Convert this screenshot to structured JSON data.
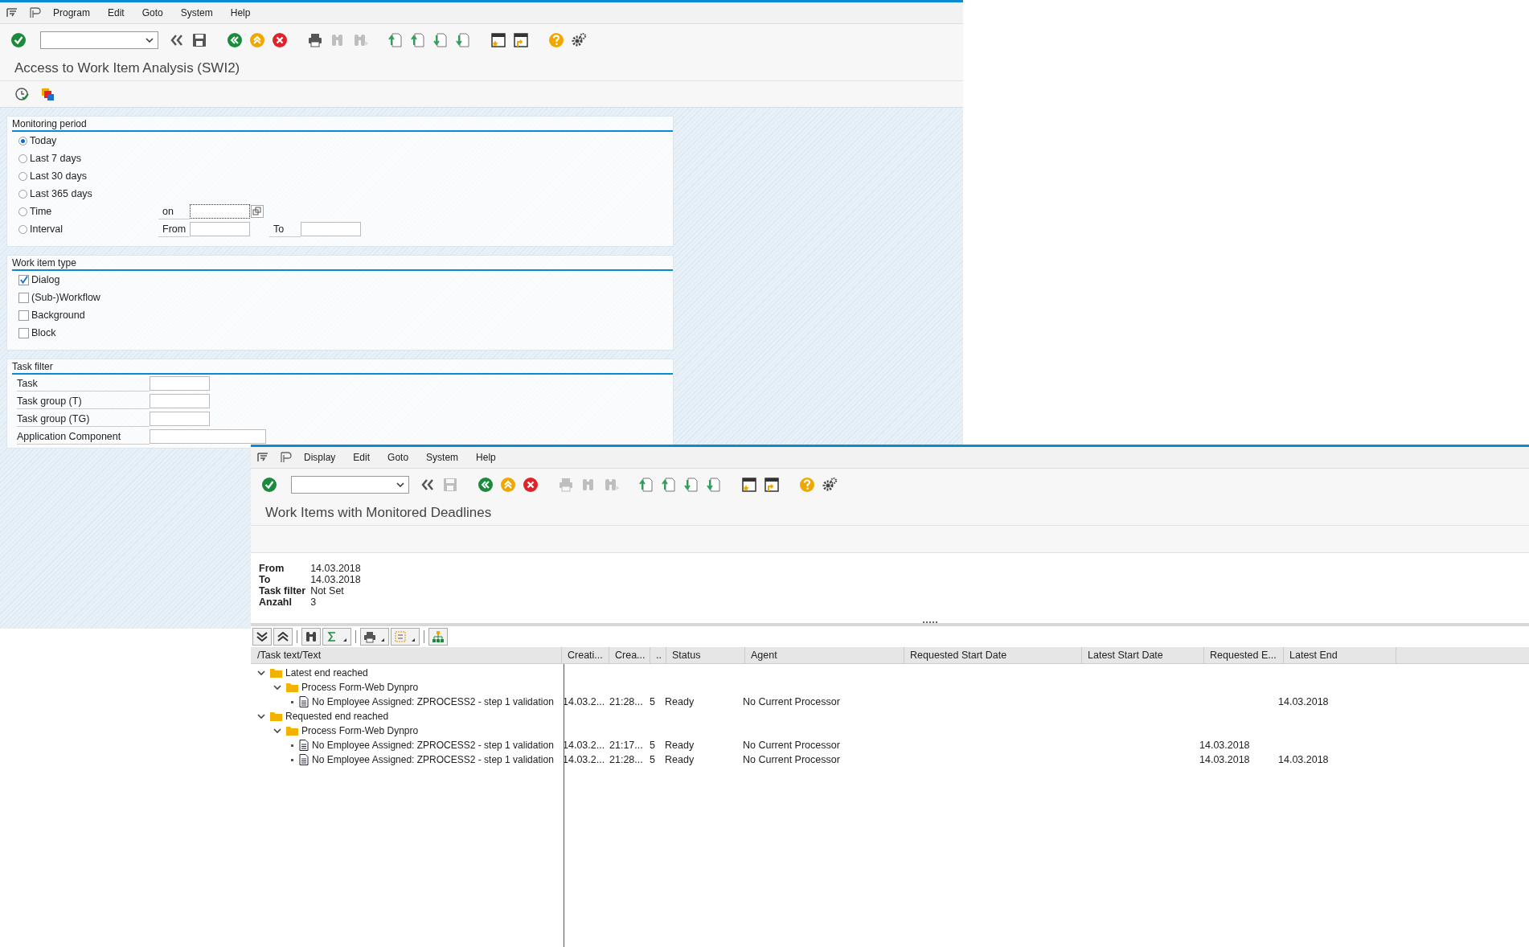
{
  "main_window": {
    "menu": [
      "Program",
      "Edit",
      "Goto",
      "System",
      "Help"
    ],
    "toolbar": [
      {
        "disabled": false
      },
      {
        "disabled": false
      },
      {
        "disabled": false
      },
      {
        "disabled": false
      },
      {
        "disabled": false
      },
      {
        "disabled": false
      },
      {
        "disabled": false
      },
      {
        "disabled": true
      },
      {
        "disabled": true
      },
      {
        "disabled": false
      },
      {
        "disabled": false
      },
      {
        "disabled": false
      },
      {
        "disabled": false
      },
      {
        "disabled": false
      },
      {
        "disabled": false
      },
      {
        "disabled": false
      },
      {
        "disabled": false
      }
    ],
    "title": "Access to Work Item Analysis (SWI2)",
    "monitoring_period": {
      "heading": "Monitoring period",
      "options": [
        {
          "label": "Today",
          "selected": true,
          "kind": "plain"
        },
        {
          "label": "Last 7 days",
          "selected": false,
          "kind": "plain"
        },
        {
          "label": "Last 30 days",
          "selected": false,
          "kind": "plain"
        },
        {
          "label": "Last 365 days",
          "selected": false,
          "kind": "plain"
        },
        {
          "label": "Time",
          "selected": false,
          "kind": "time"
        },
        {
          "label": "Interval",
          "selected": false,
          "kind": "interval"
        }
      ],
      "on_label": "on",
      "from_label": "From",
      "to_label": "To"
    },
    "work_item_type": {
      "heading": "Work item type",
      "options": [
        {
          "label": "Dialog",
          "checked": true
        },
        {
          "label": "(Sub-)Workflow",
          "checked": false
        },
        {
          "label": "Background",
          "checked": false
        },
        {
          "label": "Block",
          "checked": false
        }
      ]
    },
    "task_filter": {
      "heading": "Task filter",
      "fields": [
        {
          "label": "Task",
          "kind": "short"
        },
        {
          "label": "Task group (T)",
          "kind": "short"
        },
        {
          "label": "Task group (TG)",
          "kind": "short"
        },
        {
          "label": "Application Component",
          "kind": "long"
        }
      ]
    }
  },
  "result_window": {
    "menu": [
      "Display",
      "Edit",
      "Goto",
      "System",
      "Help"
    ],
    "toolbar": [
      {
        "disabled": false
      },
      {
        "disabled": false
      },
      {
        "disabled": true
      },
      {
        "disabled": false
      },
      {
        "disabled": false
      },
      {
        "disabled": false
      },
      {
        "disabled": true
      },
      {
        "disabled": true
      },
      {
        "disabled": true
      },
      {
        "disabled": false
      },
      {
        "disabled": false
      },
      {
        "disabled": false
      },
      {
        "disabled": false
      },
      {
        "disabled": false
      },
      {
        "disabled": false
      },
      {
        "disabled": false
      },
      {
        "disabled": false
      }
    ],
    "title": "Work Items with Monitored Deadlines",
    "info": [
      {
        "label": "From",
        "value": "14.03.2018"
      },
      {
        "label": "To",
        "value": "14.03.2018"
      },
      {
        "label": "Task filter",
        "value": "Not Set"
      },
      {
        "label": "Anzahl",
        "value": "3"
      }
    ],
    "table": {
      "columns": [
        "/Task text/Text",
        "Creati...",
        "Crea...",
        "..",
        "Status",
        "Agent",
        "Requested Start Date",
        "Latest Start Date",
        "Requested E...",
        "Latest End"
      ],
      "rows": [
        {
          "text": "Latest end reached",
          "expanded": true,
          "children": [
            {
              "text": "Process Form-Web Dynpro",
              "expanded": true,
              "children": [
                {
                  "text": "No Employee Assigned: ZPROCESS2 - step 1 validation",
                  "cells": [
                    "14.03.2...",
                    "21:28...",
                    "5",
                    "Ready",
                    "No Current Processor",
                    null,
                    null,
                    null,
                    "14.03.2018"
                  ]
                }
              ]
            }
          ]
        },
        {
          "text": "Requested end reached",
          "expanded": true,
          "children": [
            {
              "text": "Process Form-Web Dynpro",
              "expanded": true,
              "children": [
                {
                  "text": "No Employee Assigned: ZPROCESS2 - step 1 validation",
                  "cells": [
                    "14.03.2...",
                    "21:17...",
                    "5",
                    "Ready",
                    "No Current Processor",
                    null,
                    null,
                    "14.03.2018",
                    null
                  ]
                },
                {
                  "text": "No Employee Assigned: ZPROCESS2 - step 1 validation",
                  "cells": [
                    "14.03.2...",
                    "21:28...",
                    "5",
                    "Ready",
                    "No Current Processor",
                    null,
                    null,
                    "14.03.2018",
                    "14.03.2018"
                  ]
                }
              ]
            }
          ]
        }
      ]
    }
  }
}
